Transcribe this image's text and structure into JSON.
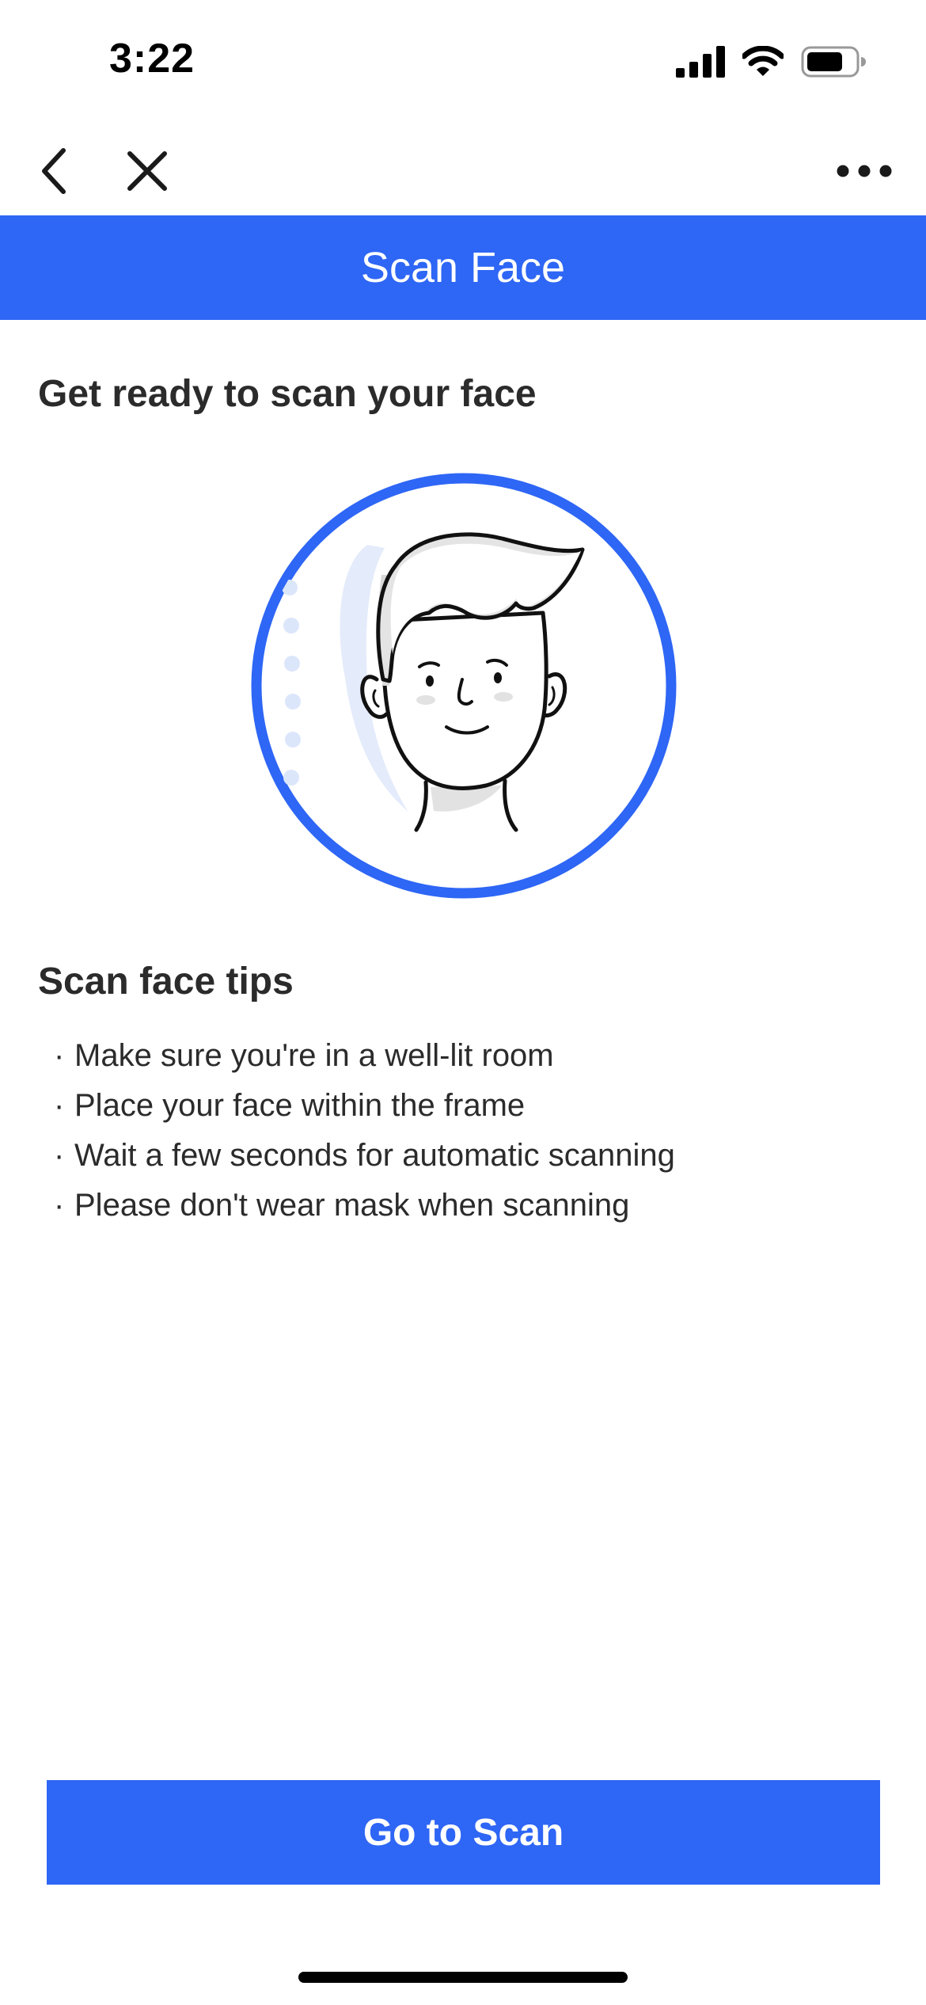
{
  "status_bar": {
    "time": "3:22"
  },
  "nav": {
    "back_icon": "chevron-left-icon",
    "close_icon": "close-icon",
    "more_icon": "more-horizontal-icon"
  },
  "header": {
    "title": "Scan Face"
  },
  "main": {
    "ready_title": "Get ready to scan your face",
    "illustration": "face-scan-illustration",
    "tips_title": "Scan face tips",
    "tips": [
      "Make sure you're in a well-lit room",
      "Place your face within the frame",
      "Wait a few seconds for automatic scanning",
      "Please don't wear mask when scanning"
    ],
    "bullet": "·"
  },
  "footer": {
    "scan_button_label": "Go to Scan"
  },
  "colors": {
    "accent": "#2e66f5",
    "text": "#2b2b2b",
    "background": "#ffffff"
  }
}
